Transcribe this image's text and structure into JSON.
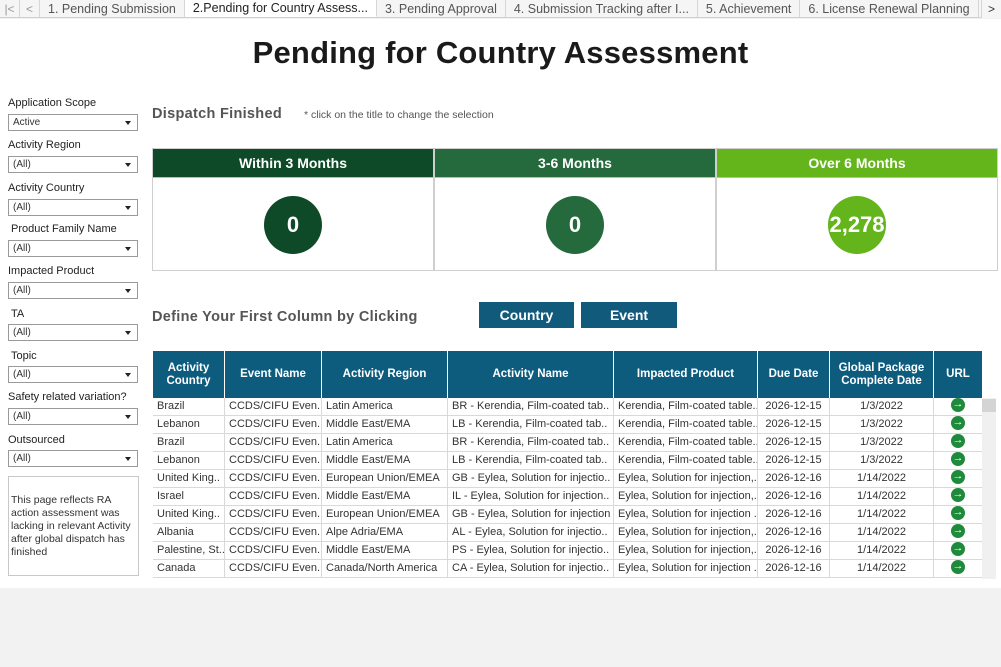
{
  "tabs": [
    {
      "label": "1. Pending Submission",
      "active": false
    },
    {
      "label": "2.Pending for Country Assess...",
      "active": true
    },
    {
      "label": "3. Pending Approval",
      "active": false
    },
    {
      "label": "4. Submission Tracking after I...",
      "active": false
    },
    {
      "label": "5. Achievement",
      "active": false
    },
    {
      "label": "6. License Renewal Planning",
      "active": false
    }
  ],
  "page_title": "Pending for Country Assessment",
  "filters": [
    {
      "label": "Application Scope",
      "value": "Active"
    },
    {
      "label": "Activity Region",
      "value": "(All)"
    },
    {
      "label": "Activity Country",
      "value": "(All)"
    },
    {
      "label": "Product Family Name",
      "value": "(All)"
    },
    {
      "label": "Impacted Product",
      "value": "(All)"
    },
    {
      "label": "TA",
      "value": "(All)"
    },
    {
      "label": "Topic",
      "value": "(All)"
    },
    {
      "label": "Safety related variation?",
      "value": "(All)"
    },
    {
      "label": "Outsourced",
      "value": "(All)"
    }
  ],
  "note": "This page reflects RA action assessment was lacking in relevant Activity after global dispatch has finished",
  "dispatch": {
    "title": "Dispatch Finished",
    "hint": "* click on the title to change the selection",
    "kpis": [
      {
        "label": "Within 3 Months",
        "value": "0",
        "color": "#0e4a28"
      },
      {
        "label": "3-6 Months",
        "value": "0",
        "color": "#256a3c"
      },
      {
        "label": "Over 6 Months",
        "value": "2,278",
        "color": "#63b51b"
      }
    ]
  },
  "define": {
    "title": "Define Your First Column by Clicking",
    "buttons": [
      "Country",
      "Event"
    ]
  },
  "table": {
    "headers": [
      "Activity Country",
      "Event Name",
      "Activity Region",
      "Activity Name",
      "Impacted Product",
      "Due Date",
      "Global Package Complete Date",
      "URL"
    ],
    "rows": [
      [
        "Brazil",
        "CCDS/CIFU Even..",
        "Latin America",
        "BR - Kerendia, Film-coated tab..",
        "Kerendia, Film-coated table..",
        "2026-12-15",
        "1/3/2022"
      ],
      [
        "Lebanon",
        "CCDS/CIFU Even..",
        "Middle East/EMA",
        "LB - Kerendia, Film-coated tab..",
        "Kerendia, Film-coated table..",
        "2026-12-15",
        "1/3/2022"
      ],
      [
        "Brazil",
        "CCDS/CIFU Even..",
        "Latin America",
        "BR - Kerendia, Film-coated tab..",
        "Kerendia, Film-coated table..",
        "2026-12-15",
        "1/3/2022"
      ],
      [
        "Lebanon",
        "CCDS/CIFU Even..",
        "Middle East/EMA",
        "LB - Kerendia, Film-coated tab..",
        "Kerendia, Film-coated table..",
        "2026-12-15",
        "1/3/2022"
      ],
      [
        "United King..",
        "CCDS/CIFU Even..",
        "European Union/EMEA",
        "GB - Eylea, Solution for injectio..",
        "Eylea, Solution for injection,..",
        "2026-12-16",
        "1/14/2022"
      ],
      [
        "Israel",
        "CCDS/CIFU Even..",
        "Middle East/EMA",
        "IL - Eylea, Solution for injection..",
        "Eylea, Solution for injection,..",
        "2026-12-16",
        "1/14/2022"
      ],
      [
        "United King..",
        "CCDS/CIFU Even..",
        "European Union/EMEA",
        "GB - Eylea, Solution for injection ..",
        "Eylea, Solution for injection ..",
        "2026-12-16",
        "1/14/2022"
      ],
      [
        "Albania",
        "CCDS/CIFU Even..",
        "Alpe Adria/EMA",
        "AL - Eylea, Solution for injectio..",
        "Eylea, Solution for injection,..",
        "2026-12-16",
        "1/14/2022"
      ],
      [
        "Palestine, St..",
        "CCDS/CIFU Even..",
        "Middle East/EMA",
        "PS - Eylea, Solution for injectio..",
        "Eylea, Solution for injection,..",
        "2026-12-16",
        "1/14/2022"
      ],
      [
        "Canada",
        "CCDS/CIFU Even..",
        "Canada/North America",
        "CA - Eylea, Solution for injectio..",
        "Eylea, Solution for injection ..",
        "2026-12-16",
        "1/14/2022"
      ]
    ]
  }
}
